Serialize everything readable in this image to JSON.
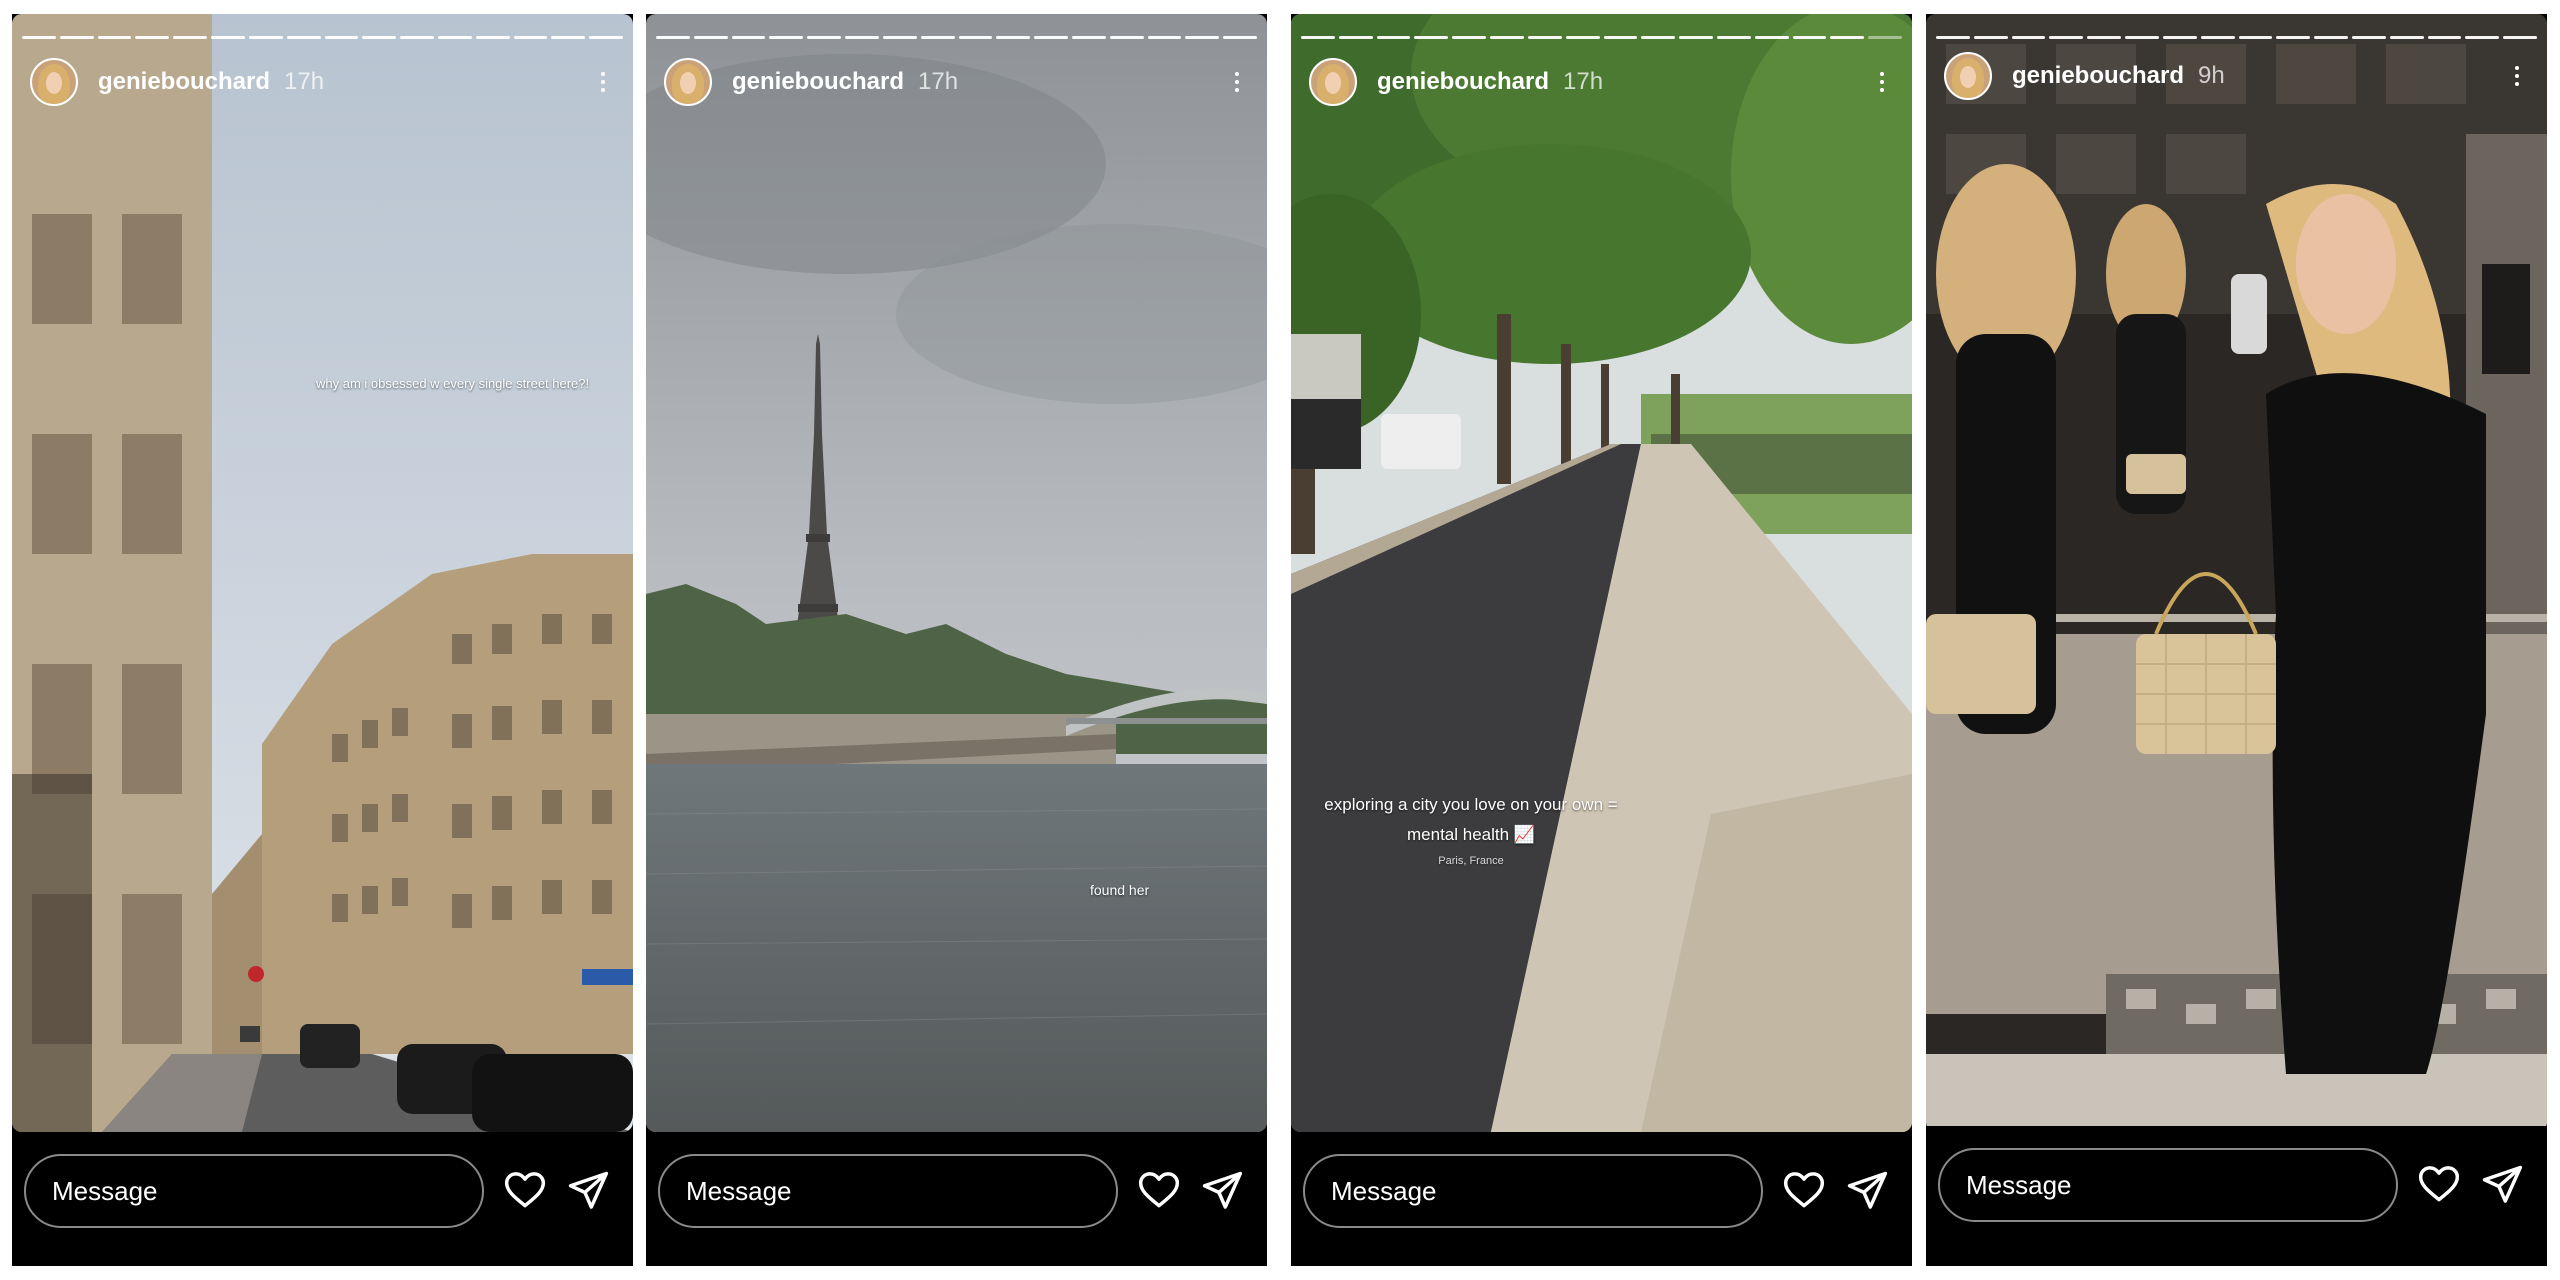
{
  "stories": [
    {
      "username": "geniebouchard",
      "time": "17h",
      "caption_lines": [
        "why am i obsessed w every single street here?!"
      ],
      "caption_sub": "",
      "message_placeholder": "Message"
    },
    {
      "username": "geniebouchard",
      "time": "17h",
      "caption_lines": [
        "found her"
      ],
      "caption_sub": "",
      "message_placeholder": "Message"
    },
    {
      "username": "geniebouchard",
      "time": "17h",
      "caption_lines": [
        "exploring a city you love on your own =",
        "mental health 📈"
      ],
      "caption_sub": "Paris, France",
      "message_placeholder": "Message"
    },
    {
      "username": "geniebouchard",
      "time": "9h",
      "caption_lines": [],
      "caption_sub": "",
      "message_placeholder": "Message"
    }
  ],
  "icons": {
    "avatar": "profile-avatar",
    "more": "more-vertical-icon",
    "like": "heart-icon",
    "share": "send-icon"
  },
  "colors": {
    "background": "#000000",
    "text": "#ffffff",
    "input_border": "#8a8a8a"
  }
}
